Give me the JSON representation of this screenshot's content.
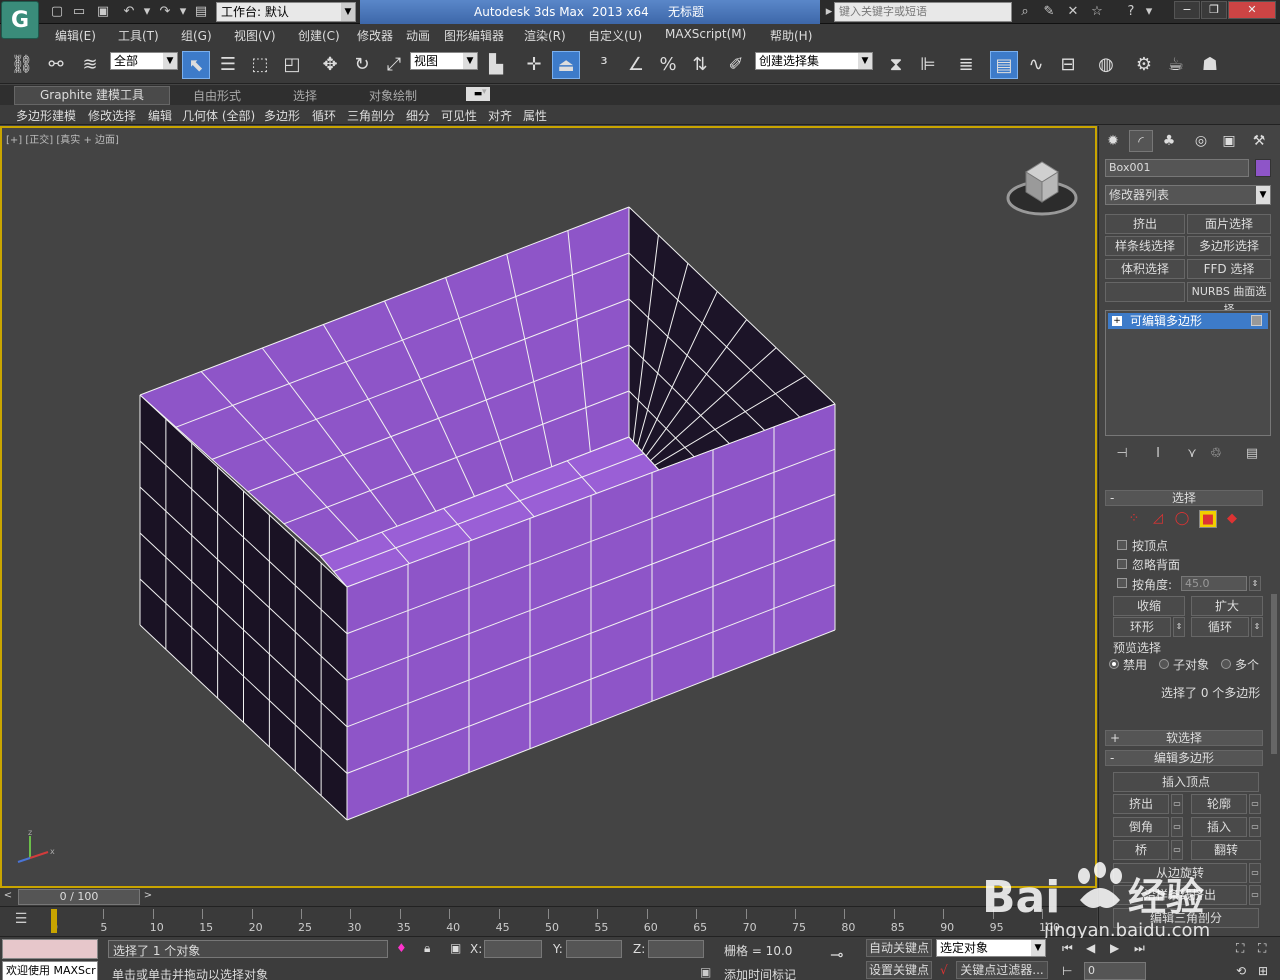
{
  "titlebar": {
    "app_logo": "G",
    "workspace_label": "工作台: 默认",
    "app_name": "Autodesk 3ds Max",
    "version": "2013 x64",
    "doc_title": "无标题",
    "search_placeholder": "键入关键字或短语"
  },
  "menu": [
    "编辑(E)",
    "工具(T)",
    "组(G)",
    "视图(V)",
    "创建(C)",
    "修改器",
    "动画",
    "图形编辑器",
    "渲染(R)",
    "自定义(U)",
    "MAXScript(M)",
    "帮助(H)"
  ],
  "toolbar": {
    "selection_filter": "全部",
    "ref_coord": "视图",
    "named_selection": "创建选择集"
  },
  "ribbon": {
    "tabs": [
      "Graphite 建模工具",
      "自由形式",
      "选择",
      "对象绘制"
    ],
    "sub_tabs": [
      "多边形建模",
      "修改选择",
      "编辑",
      "几何体 (全部)",
      "多边形",
      "循环",
      "三角剖分",
      "细分",
      "可见性",
      "对齐",
      "属性"
    ]
  },
  "viewport": {
    "label_left": "[+]",
    "label_view": "[正交]",
    "label_shading": "[真实 + 边面]",
    "object_color": "#8e55c8",
    "selected_color": "#9a5fd6"
  },
  "command_panel": {
    "object_name": "Box001",
    "modifier_list": "修改器列表",
    "quick_buttons": [
      "挤出",
      "面片选择",
      "样条线选择",
      "多边形选择",
      "体积选择",
      "FFD 选择",
      "",
      "NURBS 曲面选择"
    ],
    "stack_item": "可编辑多边形",
    "selection": {
      "title": "选择",
      "by_vertex": "按顶点",
      "ignore_backfacing": "忽略背面",
      "by_angle": "按角度:",
      "angle_value": "45.0",
      "shrink": "收缩",
      "grow": "扩大",
      "ring": "环形",
      "loop": "循环",
      "preview_title": "预览选择",
      "preview_options": [
        "禁用",
        "子对象",
        "多个"
      ],
      "status": "选择了 0 个多边形"
    },
    "soft_selection": "软选择",
    "edit_polygons": {
      "title": "编辑多边形",
      "insert_vertex": "插入顶点",
      "extrude": "挤出",
      "outline": "轮廓",
      "bevel": "倒角",
      "inset": "插入",
      "bridge": "桥",
      "flip": "翻转",
      "hinge": "从边旋转",
      "extrude_along_spline": "沿样条线挤出",
      "edit_triangulation": "编辑三角剖分"
    }
  },
  "timeline": {
    "frame_display": "0 / 100",
    "ticks": [
      "0",
      "5",
      "10",
      "15",
      "20",
      "25",
      "30",
      "35",
      "40",
      "45",
      "50",
      "55",
      "60",
      "65",
      "70",
      "75",
      "80",
      "85",
      "90",
      "95",
      "100"
    ]
  },
  "status": {
    "welcome": "欢迎使用 MAXScr",
    "selected": "选择了 1 个对象",
    "prompt": "单击或单击并拖动以选择对象",
    "x_label": "X:",
    "y_label": "Y:",
    "z_label": "Z:",
    "grid": "栅格 = 10.0",
    "auto_key": "自动关键点",
    "set_key": "设置关键点",
    "key_mode": "选定对象",
    "key_filters": "关键点过滤器...",
    "add_time_tag": "添加时间标记",
    "frame": "0"
  },
  "watermark": {
    "brand": "Bai",
    "brand_cn": "经验",
    "url": "jingyan.baidu.com"
  }
}
